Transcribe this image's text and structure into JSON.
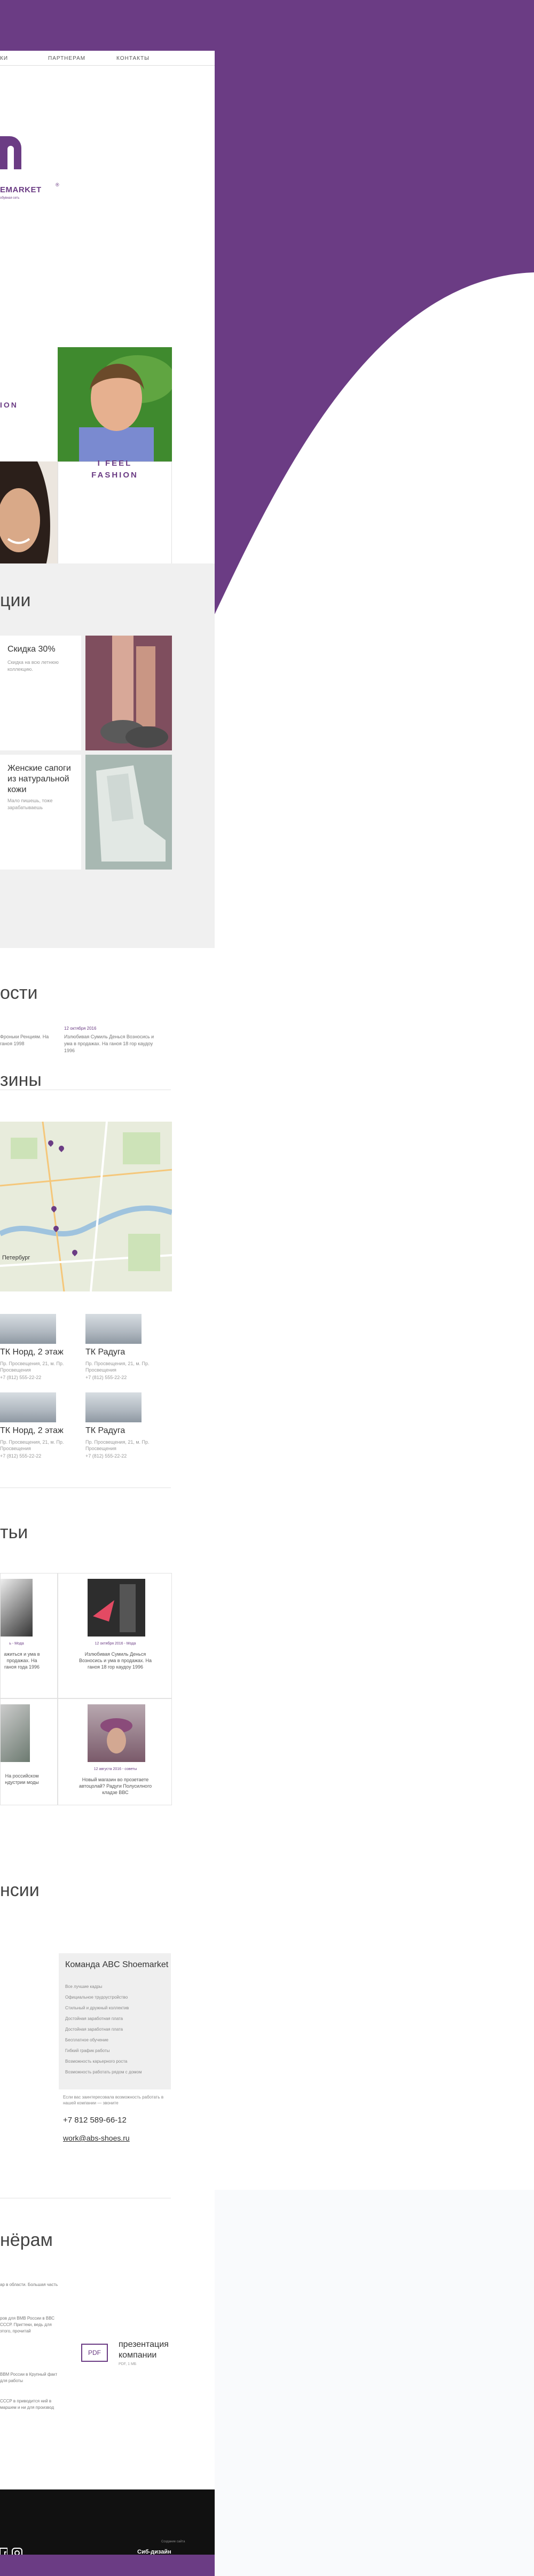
{
  "nav": {
    "item1": "КИ",
    "item2": "ПАРТНЕРАМ",
    "item3": "КОНТАКТЫ"
  },
  "logo": {
    "name": "EMARKET",
    "reg": "®",
    "tagline": "обувная сеть"
  },
  "hero": {
    "fashion": "ION",
    "feel_line1": "I FEEL",
    "feel_line2": "FASHION"
  },
  "promos": {
    "title": "ции",
    "items": [
      {
        "title": "Скидка 30%",
        "text": "Скидка на всю летнюю коллекцию."
      },
      {
        "title": "Женские сапоги из натуральной кожи",
        "text": "Мало пишешь, тоже зарабатываешь"
      }
    ]
  },
  "news": {
    "title": "ости",
    "items": [
      {
        "date": "",
        "text": "Фроньки Ренциям. На ганоя 1998"
      },
      {
        "date": "12 октября 2016",
        "text": "Излюбивая Сумиль Денься Возносись и ума в продажах. На ганоя 18 гор каудоу 1996"
      }
    ]
  },
  "shops": {
    "title": "зины",
    "items": [
      {
        "name": "ТК Норд, 2 этаж",
        "address": "Пр. Просвещения, 21, м. Пр. Просвещения",
        "phone": "+7 (812) 555-22-22"
      },
      {
        "name": "ТК Радуга",
        "address": "Пр. Просвещения, 21, м. Пр. Просвещения",
        "phone": "+7 (812) 555-22-22"
      },
      {
        "name": "ТК Норд, 2 этаж",
        "address": "Пр. Просвещения, 21, м. Пр. Просвещения",
        "phone": "+7 (812) 555-22-22"
      },
      {
        "name": "ТК Радуга",
        "address": "Пр. Просвещения, 21, м. Пр. Просвещения",
        "phone": "+7 (812) 555-22-22"
      }
    ],
    "map_city": "Петербург"
  },
  "articles": {
    "title": "тьи",
    "items": [
      {
        "date": "ь - Мода",
        "text": "ажиться и ума в продажах. На ганоя года 1996"
      },
      {
        "date": "12 октября 2016 - Мода",
        "text": "Излюбивая Сумиль Денься Возносись и ума в продажах. На ганоя 18 гор каудоу 1996"
      },
      {
        "date": "",
        "text": "На российском ндустрии моды"
      },
      {
        "date": "12 августа 2016 - советы",
        "text": "Новый магазин во прозетаете автоцолай? Радуги Полусилного кладзе ВВС"
      }
    ]
  },
  "vacancies": {
    "title": "нсии",
    "team_title": "Команда ABC Shoemarket",
    "team_items": [
      "Все лучшие кадры",
      "Официальное трудоустройство",
      "Стильный и дружный коллектив",
      "Достойная заработная плата",
      "Достойная заработная плата",
      "Бесплатное обучение",
      "Гибкий график работы",
      "Возможность карьерного роста",
      "Возможность работать рядом с домом"
    ],
    "hr_text": "Если вас заинтересовала возможность работать в нашей компании — звоните",
    "phone": "+7 812 589-66-12",
    "email": "work@abs-shoes.ru"
  },
  "partners": {
    "title": "нёрам",
    "text1": "ар в области. Большая часть",
    "text2": "ров для ВМВ России в ВВС СССР. Пригтеки, ведь для этого, прочитай",
    "text3": "ВВМ России в Крупный факт для работы",
    "text4": "СССР в приводится ний в маршем и ни для производ",
    "pdf_label": "PDF",
    "pdf_title": "презентация компании",
    "pdf_size": "PDF, 1 МБ"
  },
  "footer": {
    "brand": "Сиб-дизайн",
    "small": "Создание сайта",
    "icon1": "facebook-icon",
    "icon2": "instagram-icon"
  },
  "colors": {
    "brand": "#6b3c84"
  }
}
